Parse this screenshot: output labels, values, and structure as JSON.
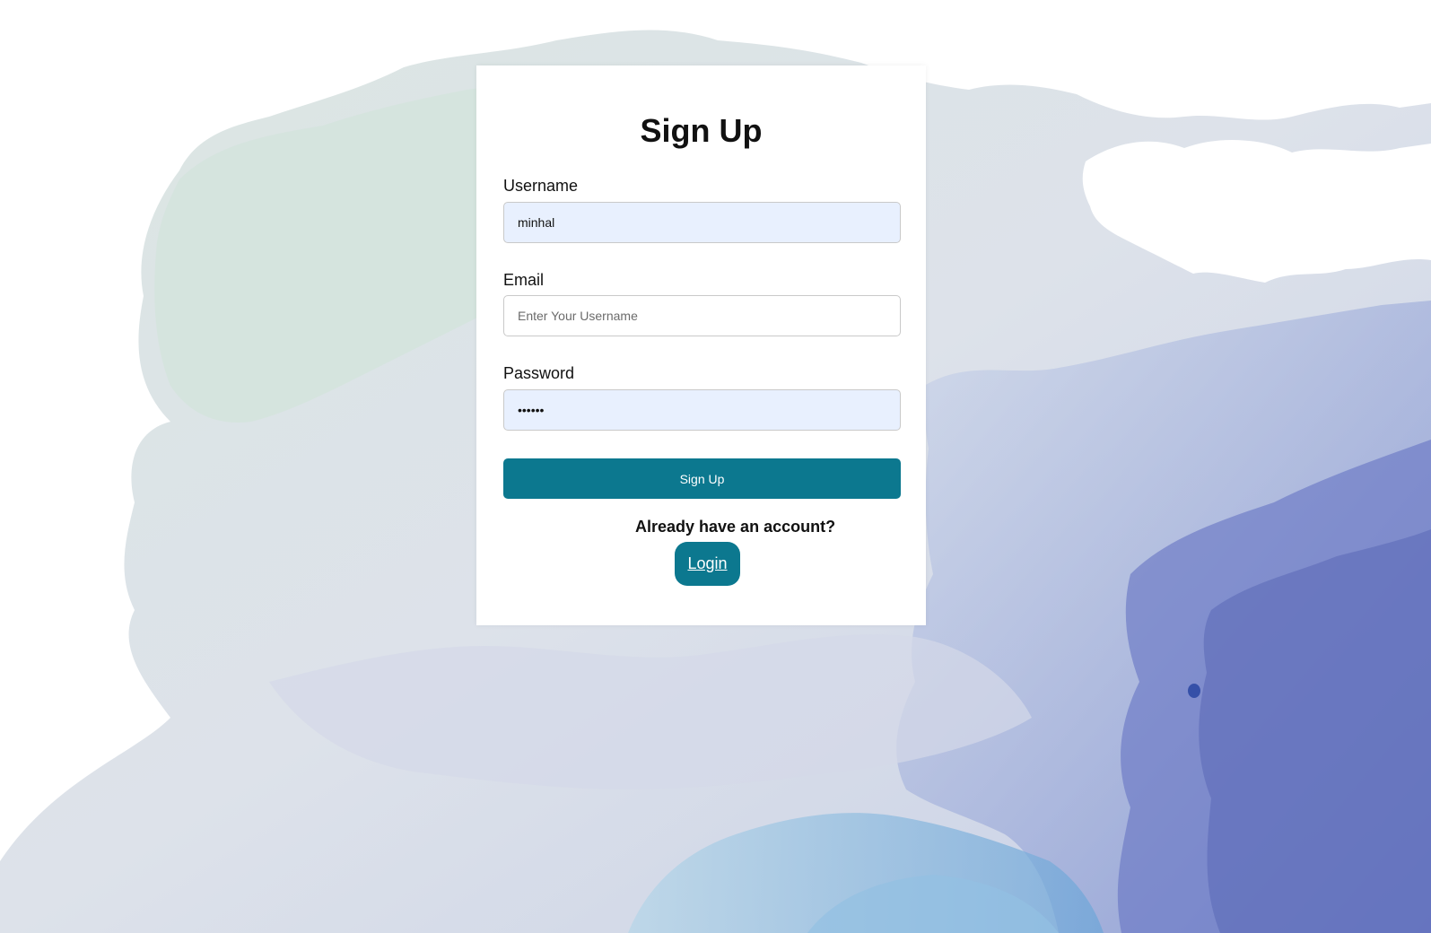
{
  "form": {
    "title": "Sign Up",
    "username": {
      "label": "Username",
      "value": "minhal",
      "placeholder": "Enter Your Username"
    },
    "email": {
      "label": "Email",
      "value": "",
      "placeholder": "Enter Your Username"
    },
    "password": {
      "label": "Password",
      "value": "••••••"
    },
    "submit_label": "Sign Up",
    "already_text": "Already have an account?",
    "login_label": "Login"
  },
  "colors": {
    "accent": "#0c788f",
    "autofill_bg": "#e8f0fe",
    "card_bg": "#ffffff"
  },
  "background": {
    "description_icon": "map-background"
  }
}
